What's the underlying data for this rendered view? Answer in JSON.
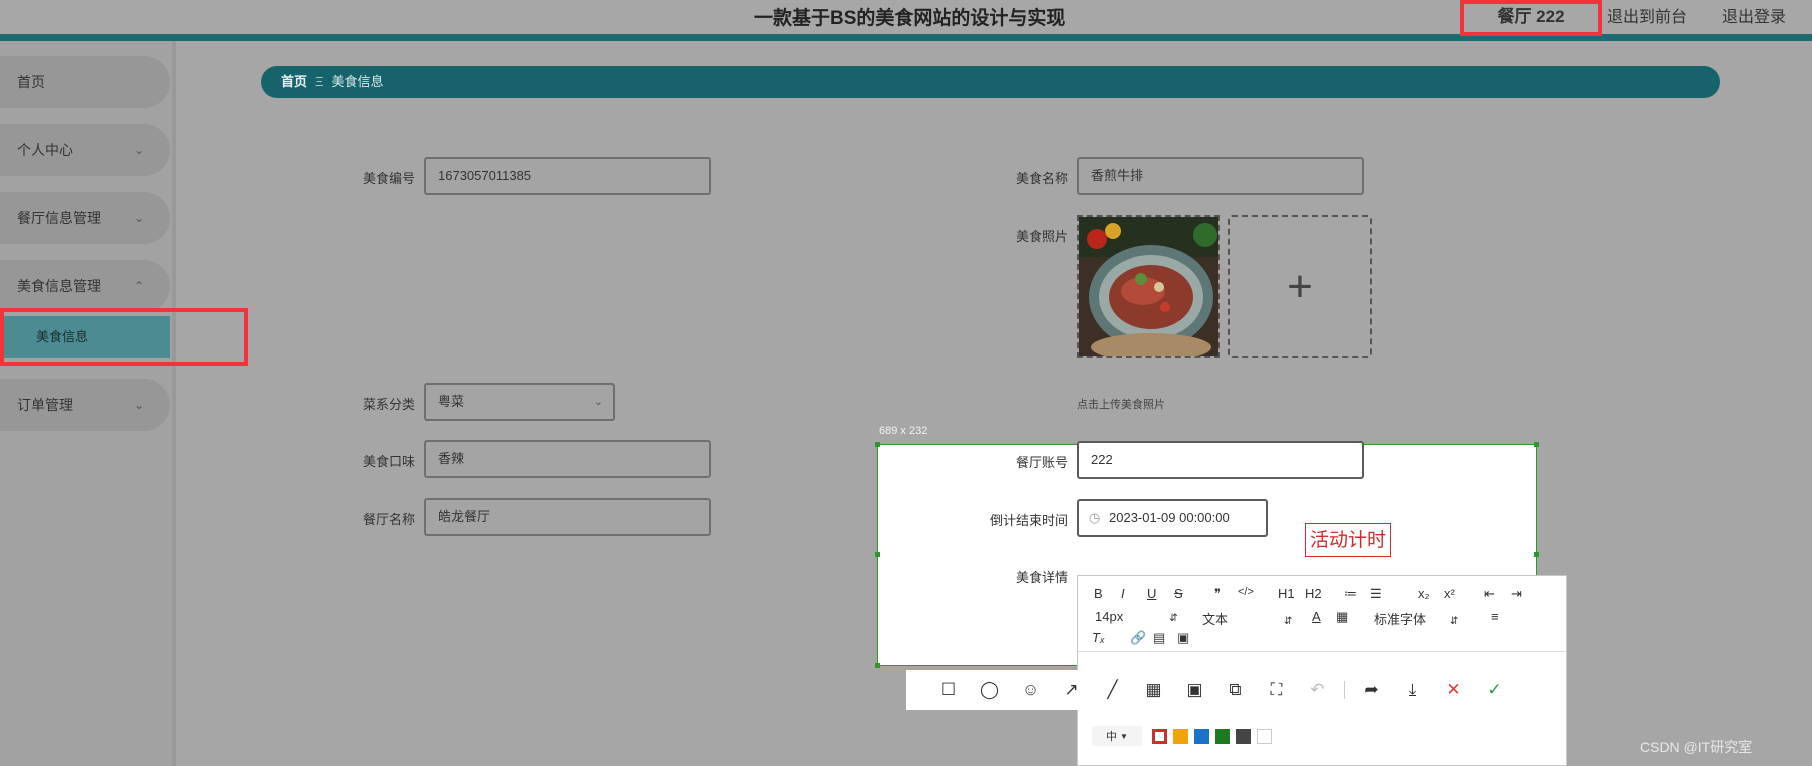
{
  "header": {
    "title": "一款基于BS的美食网站的设计与实现",
    "user_label": "餐厅 222",
    "front_link": "退出到前台",
    "logout_link": "退出登录"
  },
  "sidebar": {
    "items": [
      {
        "label": "首页"
      },
      {
        "label": "个人中心"
      },
      {
        "label": "餐厅信息管理"
      },
      {
        "label": "美食信息管理"
      },
      {
        "label": "订单管理"
      }
    ],
    "sub_item": "美食信息"
  },
  "breadcrumb": {
    "home": "首页",
    "sep": "Ξ",
    "current": "美食信息"
  },
  "form": {
    "food_id": {
      "label": "美食编号",
      "value": "1673057011385"
    },
    "food_name": {
      "label": "美食名称",
      "value": "香煎牛排"
    },
    "food_photo": {
      "label": "美食照片",
      "hint": "点击上传美食照片",
      "upload_symbol": "+"
    },
    "cuisine": {
      "label": "菜系分类",
      "value": "粤菜"
    },
    "taste": {
      "label": "美食口味",
      "value": "香辣"
    },
    "restaurant_name": {
      "label": "餐厅名称",
      "value": "皓龙餐厅"
    },
    "restaurant_account": {
      "label": "餐厅账号",
      "value": "222"
    },
    "countdown_end": {
      "label": "倒计结束时间",
      "value": "2023-01-09 00:00:00"
    },
    "details": {
      "label": "美食详情"
    }
  },
  "editor": {
    "toolbar_row1": [
      "B",
      "I",
      "U",
      "S",
      "❞",
      "</>",
      "H1",
      "H2",
      "≔",
      "☰",
      "x₂",
      "x²",
      "⇤",
      "⇥"
    ],
    "font_size": "14px",
    "paragraph": "文本",
    "font_family": "标准字体"
  },
  "capture": {
    "size_label": "689 x 232",
    "annotation_text": "活动计时",
    "brush_size": "中",
    "colors": [
      "#d32b2b",
      "#f0a30a",
      "#1a73c9",
      "#1f7a1f",
      "#444444",
      "#ffffff"
    ]
  },
  "watermark": "CSDN @IT研究室"
}
